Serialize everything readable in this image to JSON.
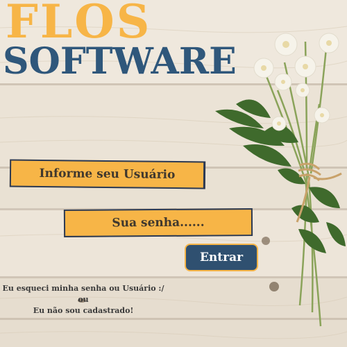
{
  "logo": {
    "line1": "FLOS",
    "line2": "SOFTWARE"
  },
  "login": {
    "user_placeholder": "Informe seu Usuário",
    "password_placeholder": "Sua senha......",
    "submit_label": "Entrar"
  },
  "links": {
    "forgot": "Eu esqueci minha senha ou Usuário :/",
    "or": "ou",
    "register": "Eu não sou cadastrado!"
  },
  "colors": {
    "accent": "#f7b547",
    "brand": "#2f577b",
    "button": "#2f5070",
    "background": "#ece4d8"
  }
}
